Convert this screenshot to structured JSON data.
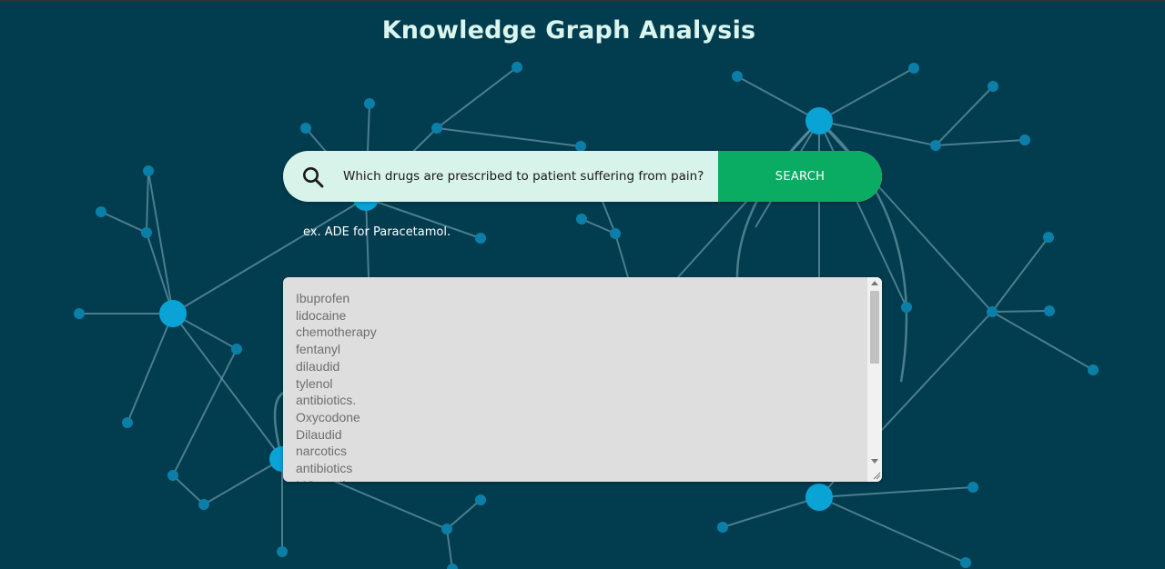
{
  "page": {
    "title": "Knowledge Graph Analysis"
  },
  "search": {
    "value": "Which drugs are prescribed to patient suffering from pain?",
    "button_label": "SEARCH",
    "hint": "ex. ADE for Paracetamol."
  },
  "results": {
    "items": [
      "Ibuprofen",
      "lidocaine",
      "chemotherapy",
      "fentanyl",
      "dilaudid",
      "tylenol",
      "antibiotics.",
      "Oxycodone",
      "Dilaudid",
      "narcotics",
      "antibiotics",
      "MS contin"
    ]
  },
  "icons": {
    "search": "search-icon",
    "scroll_up": "scroll-up-arrow-icon",
    "scroll_down": "scroll-down-arrow-icon",
    "resize": "resize-handle-icon"
  },
  "colors": {
    "background": "#023c4f",
    "title": "#d9f5ee",
    "search_bar": "#d8f3e9",
    "button": "#0aab63",
    "node": "#0aa3d6",
    "edge": "#6a9aa8"
  }
}
